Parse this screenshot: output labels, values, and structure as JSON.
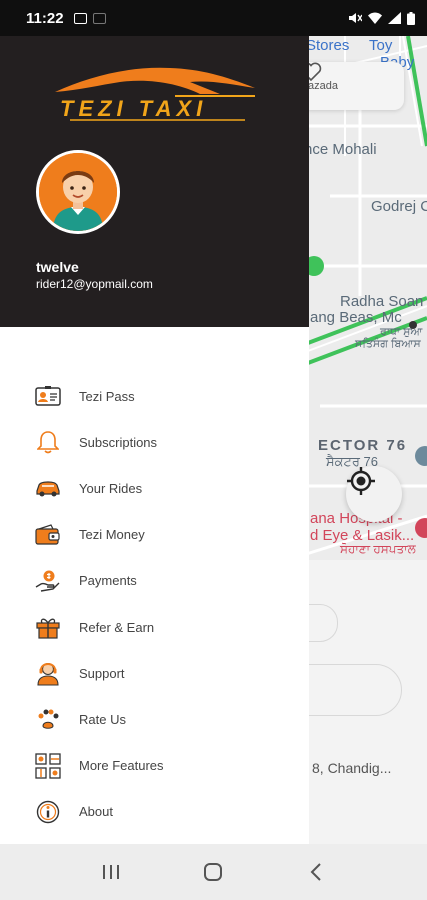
{
  "status_bar": {
    "time": "11:22"
  },
  "map": {
    "labels": [
      "Stores",
      "Toy",
      "Baby",
      "nce Mohali",
      "Godrej C",
      "Radha Soan",
      "ang Beas, Mc",
      "ਰਾਧਾ ਸੁਆ",
      "ਸਤਿਸੰਗ ਬਿਆਸ",
      "ECTOR 76",
      "ਸੈਕਟਰ 76",
      "ana Hospital -",
      "d Eye & Lasik...",
      "ਸੋਹਾਣਾ ਹਸਪਤਾਲ"
    ],
    "search_text": "azada",
    "sheet_address": "8, Chandig..."
  },
  "drawer": {
    "brand": "TEZI TAXI",
    "user": {
      "name": "twelve",
      "email": "rider12@yopmail.com"
    },
    "menu": [
      {
        "label": "Tezi Pass",
        "icon": "id-card-icon"
      },
      {
        "label": "Subscriptions",
        "icon": "bell-icon"
      },
      {
        "label": "Your Rides",
        "icon": "car-icon"
      },
      {
        "label": "Tezi Money",
        "icon": "wallet-icon"
      },
      {
        "label": "Payments",
        "icon": "payment-hand-icon"
      },
      {
        "label": "Refer & Earn",
        "icon": "gift-icon"
      },
      {
        "label": "Support",
        "icon": "support-agent-icon"
      },
      {
        "label": "Rate Us",
        "icon": "rate-paw-icon"
      },
      {
        "label": "More Features",
        "icon": "features-grid-icon"
      },
      {
        "label": "About",
        "icon": "info-icon"
      }
    ]
  },
  "colors": {
    "brand_orange": "#ef7d1c",
    "header_dark": "#231f20",
    "road_green": "#3fc25a"
  }
}
